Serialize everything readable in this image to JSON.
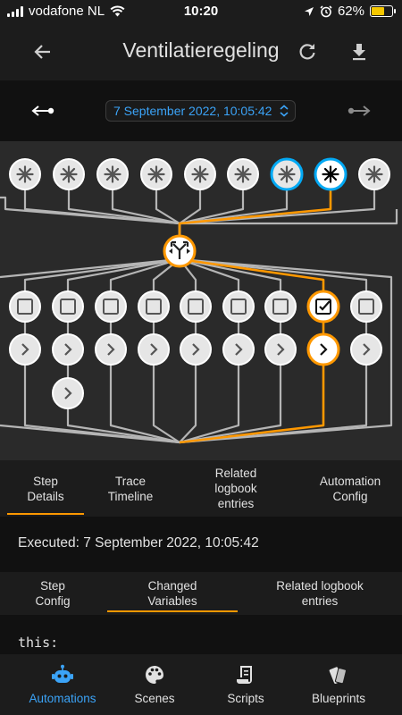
{
  "status_bar": {
    "carrier": "vodafone NL",
    "time": "10:20",
    "battery_percent": "62%",
    "battery_level": 0.62
  },
  "header": {
    "title": "Ventilatieregeling"
  },
  "timeline": {
    "selected_datetime": "7 September 2022, 10:05:42"
  },
  "main_tabs": [
    {
      "label": "Step\nDetails",
      "active": true
    },
    {
      "label": "Trace\nTimeline",
      "active": false
    },
    {
      "label": "Related\nlogbook\nentries",
      "active": false
    },
    {
      "label": "Automation\nConfig",
      "active": false
    }
  ],
  "executed": {
    "text": "Executed: 7 September 2022, 10:05:42"
  },
  "detail_tabs": [
    {
      "label": "Step\nConfig",
      "active": false
    },
    {
      "label": "Changed\nVariables",
      "active": true
    },
    {
      "label": "Related logbook\nentries",
      "active": false
    }
  ],
  "code": {
    "first_line": "this:"
  },
  "bottom_nav": [
    {
      "label": "Automations",
      "icon": "robot-icon",
      "active": true
    },
    {
      "label": "Scenes",
      "icon": "palette-icon",
      "active": false
    },
    {
      "label": "Scripts",
      "icon": "script-icon",
      "active": false
    },
    {
      "label": "Blueprints",
      "icon": "blueprint-icon",
      "active": false
    }
  ],
  "colors": {
    "accent_orange": "#ff9800",
    "accent_blue": "#3ba3f7",
    "trigger_blue": "#03a9f4",
    "line_gray": "#b5b5b5",
    "node_fill": "#e6e6e6"
  }
}
